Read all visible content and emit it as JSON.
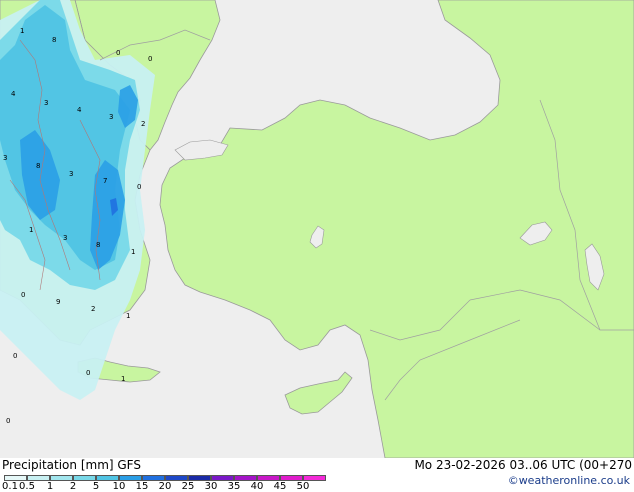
{
  "map": {
    "region_labels": [
      "1",
      "8",
      "0",
      "0",
      "4",
      "3",
      "4",
      "3",
      "2",
      "3",
      "8",
      "3",
      "7",
      "0",
      "1",
      "3",
      "8",
      "1",
      "0",
      "9",
      "2",
      "1",
      "0",
      "0",
      "1",
      "0"
    ]
  },
  "footer": {
    "title": "Precipitation [mm]  GFS",
    "datetime": "Mo 23-02-2026 03..06 UTC (00+270",
    "credit": "©weatheronline.co.uk",
    "scale_labels": [
      "0.1",
      "0.5",
      "1",
      "2",
      "5",
      "10",
      "15",
      "20",
      "25",
      "30",
      "35",
      "40",
      "45",
      "50"
    ],
    "scale_colors": [
      "#e6f8f8",
      "#c8f0f2",
      "#a2e6ee",
      "#78d8e8",
      "#50c4e4",
      "#2a9ee6",
      "#2070e0",
      "#1e48c8",
      "#1a2aa6",
      "#7a18c8",
      "#a414c8",
      "#c818c8",
      "#e01ccc",
      "#f42ad8"
    ]
  },
  "colors": {
    "sea": "#eeeeee",
    "land": "#c8f5a0",
    "border": "#a0a0a0"
  }
}
